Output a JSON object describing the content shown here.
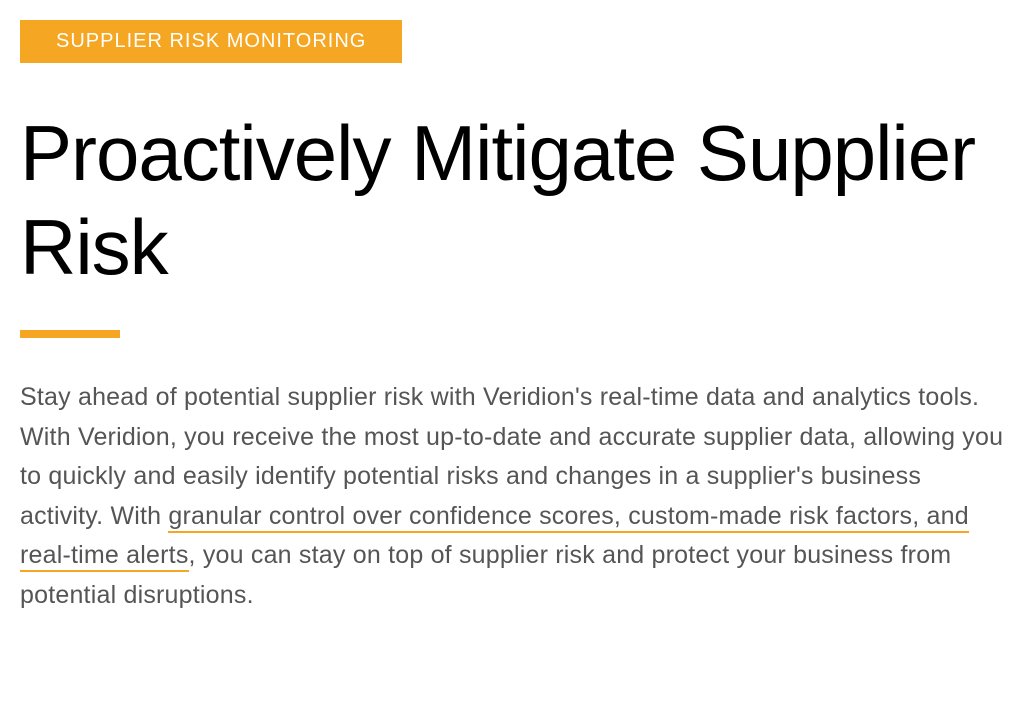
{
  "tag": "SUPPLIER RISK MONITORING",
  "headline": "Proactively Mitigate Supplier Risk",
  "body": {
    "pre": "Stay ahead of potential supplier risk with Veridion's real-time data and analytics tools. With Veridion, you receive the most up-to-date and accurate supplier data, allowing you to quickly and easily identify potential risks and changes in a supplier's business activity. With ",
    "highlight1": "granular control over confidence scores, custom-made risk factors, and real-time alerts",
    "post": ", you can stay on top of supplier risk and protect your business from potential disruptions."
  }
}
